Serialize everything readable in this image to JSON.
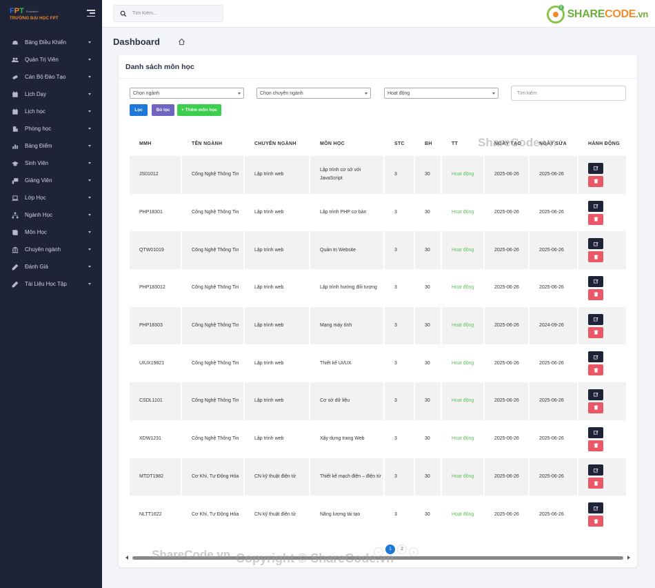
{
  "sidebar": {
    "logo_brand": "FPT",
    "logo_sub": "Education",
    "logo_school": "TRƯỜNG ĐẠI HỌC FPT",
    "items": [
      {
        "label": "Bảng Điều Khiển",
        "icon": "dashboard-icon"
      },
      {
        "label": "Quản Trị Viên",
        "icon": "users-icon"
      },
      {
        "label": "Cán Bộ Đào Tạo",
        "icon": "pills-icon"
      },
      {
        "label": "Lịch Dạy",
        "icon": "calendar-icon"
      },
      {
        "label": "Lịch học",
        "icon": "calendar-icon"
      },
      {
        "label": "Phòng học",
        "icon": "building-icon"
      },
      {
        "label": "Bảng Điểm",
        "icon": "chart-icon"
      },
      {
        "label": "Sinh Viên",
        "icon": "graduation-cap-icon"
      },
      {
        "label": "Giảng Viên",
        "icon": "teacher-icon"
      },
      {
        "label": "Lớp Học",
        "icon": "laptop-icon"
      },
      {
        "label": "Ngành Học",
        "icon": "sitemap-icon"
      },
      {
        "label": "Môn Học",
        "icon": "book-icon"
      },
      {
        "label": "Chuyên ngành",
        "icon": "university-icon"
      },
      {
        "label": "Đánh Giá",
        "icon": "pencil-icon"
      },
      {
        "label": "Tài Liệu Học Tập",
        "icon": "pencil-icon"
      }
    ]
  },
  "topbar": {
    "search_placeholder": "Tìm Kiếm...",
    "brand_part1": "SHARE",
    "brand_part2": "CODE",
    "brand_part3": ".vn",
    "brand_badge": "3"
  },
  "page": {
    "title": "Dashboard"
  },
  "card": {
    "title": "Danh sách môn học",
    "filter_major": "Chọn ngành",
    "filter_specialization": "Chọn chuyên ngành",
    "filter_status": "Hoạt động",
    "search_placeholder": "Tìm kiếm",
    "btn_filter": "Lọc",
    "btn_clear": "Bỏ lọc",
    "btn_add": "+ Thêm môn học"
  },
  "table": {
    "headers": [
      "MMH",
      "TÊN NGÀNH",
      "CHUYÊN NGÀNH",
      "MÔN HỌC",
      "STC",
      "BH",
      "TT",
      "NGÀY TẠO",
      "NGÀY SỬA",
      "HÀNH ĐỘNG"
    ],
    "rows": [
      {
        "mmh": "JS01012",
        "nganh": "Công Nghệ Thông Tin",
        "chuyen": "Lập trình web",
        "mon": "Lập trình cơ sở với JavaScript",
        "stc": "3",
        "bh": "30",
        "tt": "Hoạt động",
        "tao": "2025-06-26",
        "sua": "2025-06-26"
      },
      {
        "mmh": "PHP18301",
        "nganh": "Công Nghệ Thông Tin",
        "chuyen": "Lập trình web",
        "mon": "Lập trình PHP cơ bản",
        "stc": "3",
        "bh": "30",
        "tt": "Hoạt động",
        "tao": "2025-06-26",
        "sua": "2025-06-26"
      },
      {
        "mmh": "QTW01019",
        "nganh": "Công Nghệ Thông Tin",
        "chuyen": "Lập trình web",
        "mon": "Quản trị Website",
        "stc": "3",
        "bh": "30",
        "tt": "Hoạt động",
        "tao": "2025-06-26",
        "sua": "2025-06-26"
      },
      {
        "mmh": "PHP183012",
        "nganh": "Công Nghệ Thông Tin",
        "chuyen": "Lập trình web",
        "mon": "Lập trình hướng đối tượng",
        "stc": "3",
        "bh": "30",
        "tt": "Hoạt động",
        "tao": "2025-06-26",
        "sua": "2025-06-26"
      },
      {
        "mmh": "PHP18303",
        "nganh": "Công Nghệ Thông Tin",
        "chuyen": "Lập trình web",
        "mon": "Mạng máy tính",
        "stc": "3",
        "bh": "30",
        "tt": "Hoạt động",
        "tao": "2025-06-26",
        "sua": "2024-09-26"
      },
      {
        "mmh": "UIUX19821",
        "nganh": "Công Nghệ Thông Tin",
        "chuyen": "Lập trình web",
        "mon": "Thiết kế UI/UX",
        "stc": "3",
        "bh": "30",
        "tt": "Hoạt động",
        "tao": "2025-06-26",
        "sua": "2025-06-26"
      },
      {
        "mmh": "CSDL1101",
        "nganh": "Công Nghệ Thông Tin",
        "chuyen": "Lập trình web",
        "mon": "Cơ sở dữ liệu",
        "stc": "3",
        "bh": "30",
        "tt": "Hoạt động",
        "tao": "2025-06-26",
        "sua": "2025-06-26"
      },
      {
        "mmh": "XDW1231",
        "nganh": "Công Nghệ Thông Tin",
        "chuyen": "Lập trình web",
        "mon": "Xây dựng trang Web",
        "stc": "3",
        "bh": "30",
        "tt": "Hoạt động",
        "tao": "2025-06-26",
        "sua": "2025-06-26"
      },
      {
        "mmh": "MTDT1982",
        "nganh": "Cơ Khí, Tự Động Hóa",
        "chuyen": "CN kỹ thuật điện tử",
        "mon": "Thiết kế mạch điện – điện tử",
        "stc": "3",
        "bh": "30",
        "tt": "Hoạt động",
        "tao": "2025-06-26",
        "sua": "2025-06-26"
      },
      {
        "mmh": "NLTT1622",
        "nganh": "Cơ Khí, Tự Động Hóa",
        "chuyen": "CN kỹ thuật điện tử",
        "mon": "Năng lượng tái tạo",
        "stc": "3",
        "bh": "30",
        "tt": "Hoạt động",
        "tao": "2025-06-26",
        "sua": "2025-06-26"
      }
    ]
  },
  "pagination": {
    "prev": "‹",
    "pages": [
      "1",
      "2"
    ],
    "next": "›",
    "active": "1"
  },
  "watermarks": {
    "w1": "ShareCode.vn",
    "w2": "ShareCode.vn",
    "w3": "Copyright © ShareCode.vn"
  },
  "colors": {
    "sidebar": "#1e2337",
    "primary": "#1d78d8",
    "clear": "#7064c2",
    "add": "#3ccf4e",
    "status_ok": "#5cc35c",
    "delete": "#ea5766"
  }
}
